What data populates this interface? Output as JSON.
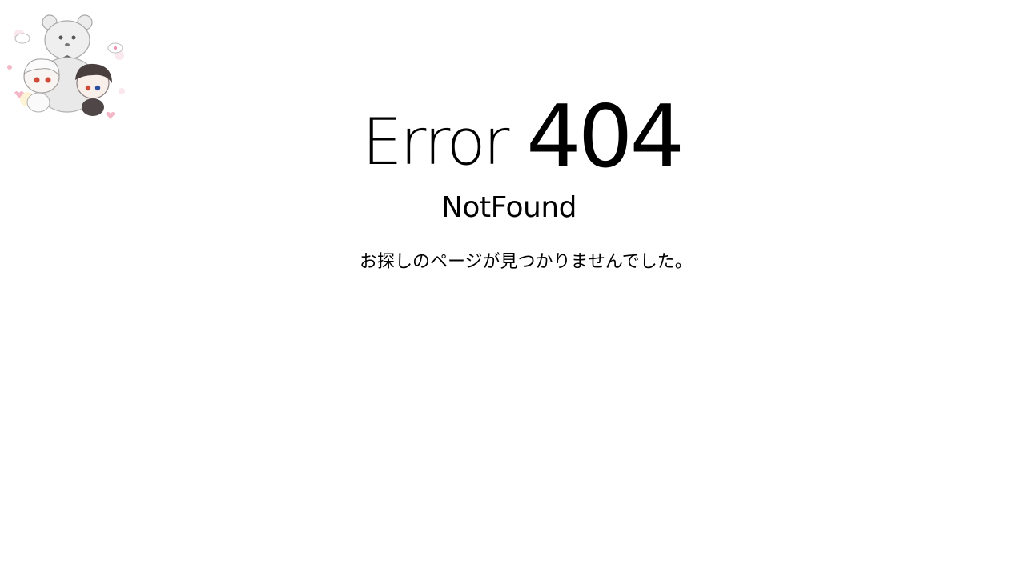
{
  "logo": {
    "icon": "chibi-bear-illustration",
    "description_colors": {
      "bear": "#e9e9e9",
      "outline": "#9a9a9a",
      "hair_dark": "#4a3f3f",
      "eye_blue": "#2a4fa0",
      "eye_red": "#d04a3a",
      "accent_pink": "#f3b7c8"
    }
  },
  "error": {
    "word": "Error",
    "code": "404",
    "subtitle": "NotFound",
    "message": "お探しのページが見つかりませんでした。"
  },
  "colors": {
    "background": "#ffffff",
    "text": "#000000"
  }
}
